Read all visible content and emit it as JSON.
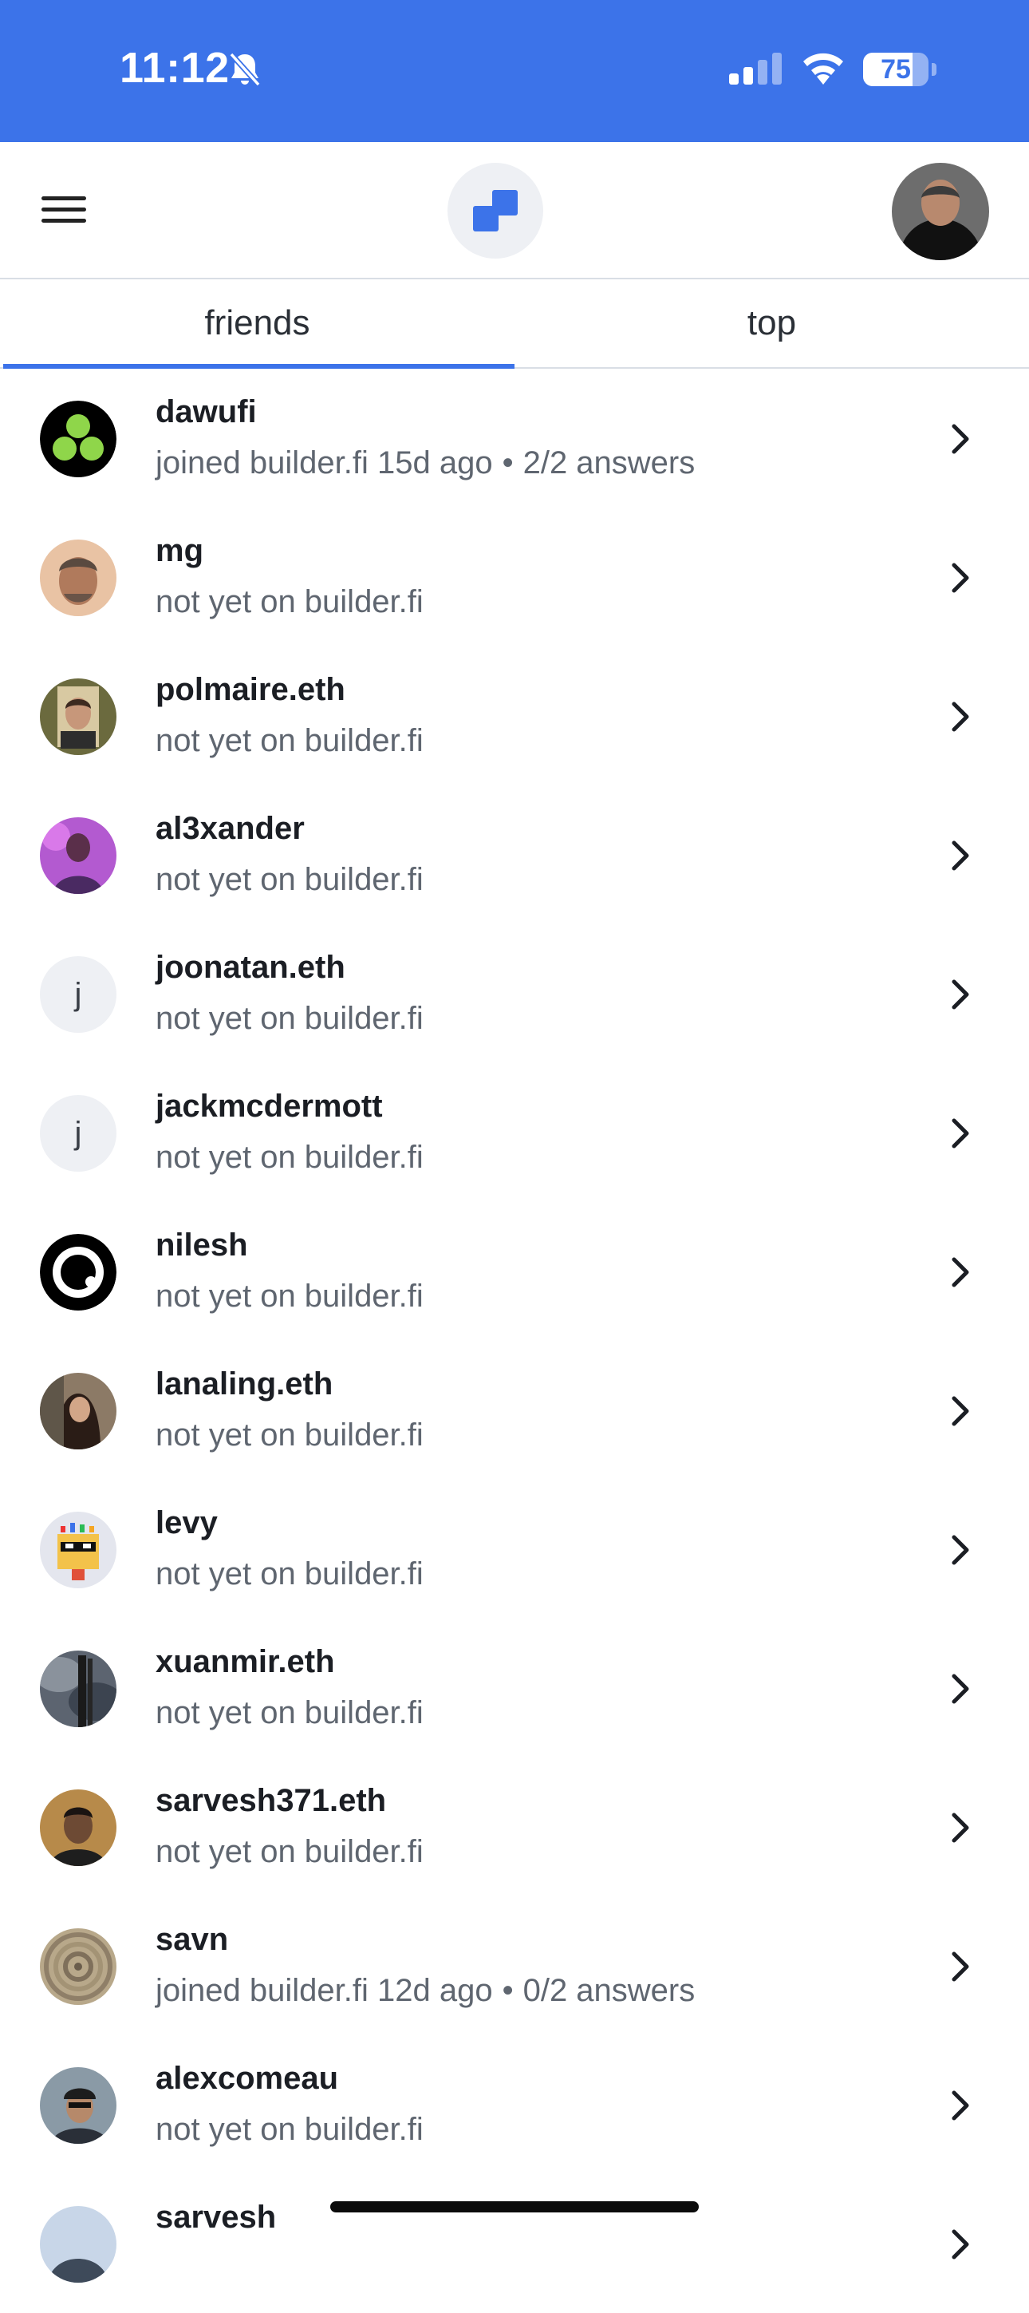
{
  "status_bar": {
    "time": "11:12",
    "battery": "75",
    "battery_level": 0.75,
    "bell_icon": "bell-slash-icon",
    "signal_icon": "cellular-signal-icon",
    "wifi_icon": "wifi-icon"
  },
  "header": {
    "menu_icon": "hamburger-menu-icon",
    "logo_icon": "builder-logo-icon",
    "avatar": "profile-avatar"
  },
  "tabs": [
    {
      "label": "friends",
      "active": true
    },
    {
      "label": "top",
      "active": false
    }
  ],
  "colors": {
    "accent": "#3c73e9",
    "text_primary": "#1b1e24",
    "text_secondary": "#5f6670",
    "divider": "#d9dee5"
  },
  "friends": [
    {
      "name": "dawufi",
      "status": "joined builder.fi 15d ago",
      "answers": "2/2 answers"
    },
    {
      "name": "mg",
      "status": "not yet on builder.fi"
    },
    {
      "name": "polmaire.eth",
      "status": "not yet on builder.fi"
    },
    {
      "name": "al3xander",
      "status": "not yet on builder.fi"
    },
    {
      "name": "joonatan.eth",
      "status": "not yet on builder.fi",
      "initial": "j"
    },
    {
      "name": "jackmcdermott",
      "status": "not yet on builder.fi",
      "initial": "j"
    },
    {
      "name": "nilesh",
      "status": "not yet on builder.fi"
    },
    {
      "name": "lanaling.eth",
      "status": "not yet on builder.fi"
    },
    {
      "name": "levy",
      "status": "not yet on builder.fi"
    },
    {
      "name": "xuanmir.eth",
      "status": "not yet on builder.fi"
    },
    {
      "name": "sarvesh371.eth",
      "status": "not yet on builder.fi"
    },
    {
      "name": "savn",
      "status": "joined builder.fi 12d ago",
      "answers": "0/2 answers"
    },
    {
      "name": "alexcomeau",
      "status": "not yet on builder.fi"
    },
    {
      "name": "sarvesh",
      "status": ""
    }
  ]
}
